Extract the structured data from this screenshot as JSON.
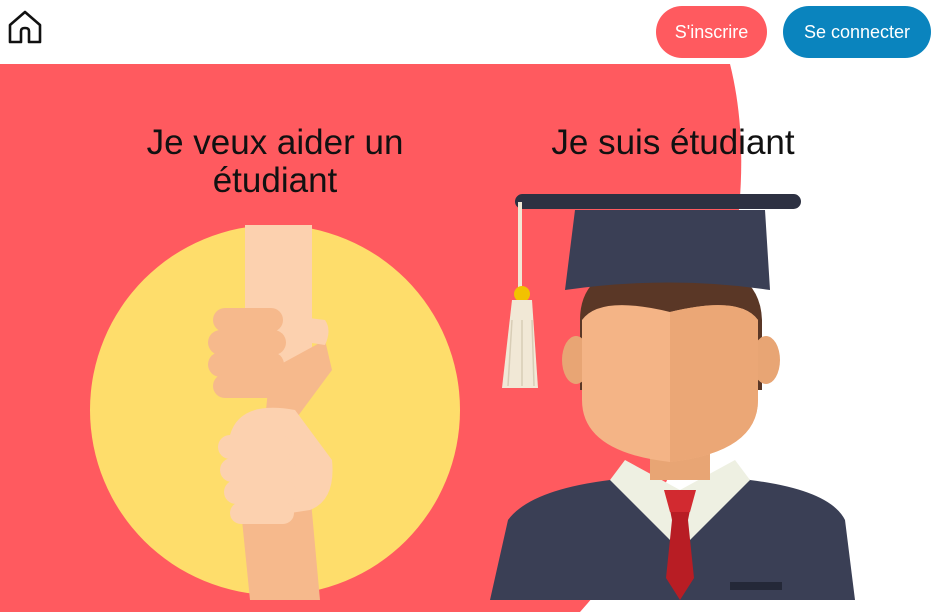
{
  "header": {
    "home_icon": "home-icon",
    "register_label": "S'inscrire",
    "login_label": "Se connecter"
  },
  "sections": {
    "helper": {
      "title": "Je veux aider un étudiant",
      "illustration": "handshake-help-icon"
    },
    "student": {
      "title": "Je suis étudiant",
      "illustration": "graduate-icon"
    }
  },
  "colors": {
    "hero_red": "#FF5A5F",
    "register_button": "#FF5A5F",
    "login_button": "#0A84BE",
    "circle_yellow": "#FEDD6B",
    "skin": "#F4B486",
    "gown": "#3A3F55"
  }
}
